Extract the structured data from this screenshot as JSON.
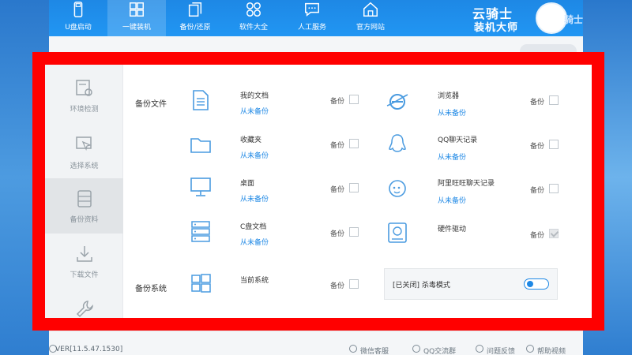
{
  "nav": {
    "items": [
      {
        "label": "U盘启动",
        "icon": "usb-drive-icon"
      },
      {
        "label": "一键装机",
        "icon": "grid-install-icon"
      },
      {
        "label": "备份/还原",
        "icon": "backup-restore-icon"
      },
      {
        "label": "软件大全",
        "icon": "apps-icon"
      },
      {
        "label": "人工服务",
        "icon": "chat-icon"
      },
      {
        "label": "官方网站",
        "icon": "home-icon"
      }
    ],
    "active_index": 1
  },
  "brand": {
    "line1": "云骑士",
    "line2": "装机大师",
    "overlay": "骑士"
  },
  "sidebar": {
    "items": [
      {
        "label": "环境检测",
        "icon": "env-check-icon"
      },
      {
        "label": "选择系统",
        "icon": "cursor-select-icon"
      },
      {
        "label": "备份资料",
        "icon": "backup-data-icon"
      },
      {
        "label": "下载文件",
        "icon": "download-icon"
      },
      {
        "label": "",
        "icon": "wrench-icon"
      }
    ],
    "active_index": 2
  },
  "main": {
    "backup_files_label": "备份文件",
    "backup_system_label": "备份系统",
    "backup_checkbox_label": "备份",
    "left_entries": [
      {
        "title": "我的文档",
        "sub": "从未备份",
        "icon": "document-icon"
      },
      {
        "title": "收藏夹",
        "sub": "从未备份",
        "icon": "folder-icon"
      },
      {
        "title": "桌面",
        "sub": "从未备份",
        "icon": "monitor-icon"
      },
      {
        "title": "C盘文档",
        "sub": "从未备份",
        "icon": "server-icon"
      }
    ],
    "right_entries": [
      {
        "title": "浏览器",
        "sub": "从未备份",
        "icon": "browser-icon"
      },
      {
        "title": "QQ聊天记录",
        "sub": "从未备份",
        "icon": "qq-icon"
      },
      {
        "title": "阿里旺旺聊天记录",
        "sub": "从未备份",
        "icon": "wangwang-icon"
      },
      {
        "title": "硬件驱动",
        "sub": "",
        "icon": "harddrive-icon"
      }
    ],
    "system_entry": {
      "title": "当前系统",
      "icon": "windows-icon"
    },
    "antivirus": {
      "text": "[已关闭] 杀毒模式"
    }
  },
  "footer": {
    "version": "VER[11.5.47.1530]",
    "links": [
      "微信客服",
      "QQ交流群",
      "问题反馈",
      "帮助视频"
    ]
  },
  "colors": {
    "accent": "#1e88e5",
    "highlight_frame": "#ff0000"
  }
}
